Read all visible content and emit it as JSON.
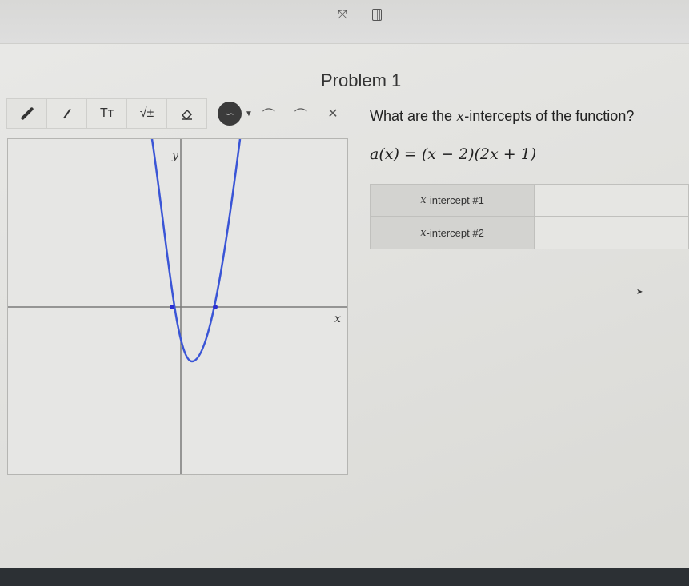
{
  "header": {
    "icons": [
      "expand-icon",
      "calculator-icon"
    ]
  },
  "problem": {
    "title": "Problem 1",
    "question_prefix": "What are the ",
    "question_var": "x",
    "question_suffix": "-intercepts of the function?",
    "formula_lhs": "a(x) = ",
    "formula_rhs": "(x − 2)(2x + 1)"
  },
  "toolbar": {
    "text_tool_label": "Tт",
    "math_tool_label": "√±",
    "tools": [
      "pencil-tool",
      "line-tool",
      "text-tool",
      "math-tool",
      "eraser-tool",
      "curve-tool",
      "arc-up-tool",
      "arc-down-tool",
      "clear-tool"
    ]
  },
  "graph": {
    "y_label": "y",
    "x_label": "x"
  },
  "answers": {
    "rows": [
      {
        "var": "x",
        "label": "-intercept #1",
        "value": ""
      },
      {
        "var": "x",
        "label": "-intercept #2",
        "value": ""
      }
    ]
  },
  "colors": {
    "curve": "#3a55d6",
    "point": "#2b2fd1",
    "axis": "#7a7a7a"
  }
}
